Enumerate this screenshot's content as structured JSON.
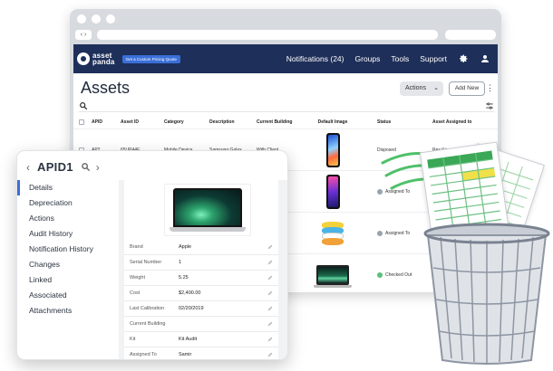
{
  "app": {
    "logo_text_1": "asset",
    "logo_text_2": "panda",
    "quote_button": "Get a Custom Pricing Quote",
    "nav": {
      "notifications": "Notifications (24)",
      "groups": "Groups",
      "tools": "Tools",
      "support": "Support"
    },
    "brand_color": "#1e2f59",
    "accent_color": "#3a6fd8"
  },
  "page": {
    "title": "Assets",
    "actions_label": "Actions",
    "add_new_label": "Add New"
  },
  "table": {
    "headers": {
      "apid": "APID",
      "asset_id": "Asset ID",
      "category": "Category",
      "description": "Description",
      "current_building": "Current Building",
      "default_image": "Default Image",
      "status": "Status",
      "assigned_to": "Asset Assigned to"
    },
    "rows": [
      {
        "apid": "AP2",
        "asset_id": "65UP44E",
        "category": "Mobile Device",
        "description": "Samsung Galax...",
        "building": "With Client",
        "status": "Disposed",
        "assigned": "Rex King",
        "status_color": "#9aa3b0"
      },
      {
        "apid": "",
        "asset_id": "",
        "category": "",
        "description": "",
        "building": "",
        "status": "Assigned To",
        "assigned": "",
        "status_color": "#9aa3b0"
      },
      {
        "apid": "",
        "asset_id": "",
        "category": "",
        "description": "",
        "building": "",
        "status": "Assigned To",
        "assigned": "",
        "status_color": "#9aa3b0"
      },
      {
        "apid": "",
        "asset_id": "",
        "category": "",
        "description": "",
        "building": "",
        "status": "Checked Out",
        "assigned": "",
        "status_color": "#5bbf7a"
      }
    ]
  },
  "detail": {
    "title": "APID1",
    "nav_prev": "‹",
    "nav_next": "›",
    "sidebar": [
      {
        "label": "Details",
        "active": true
      },
      {
        "label": "Depreciation",
        "active": false
      },
      {
        "label": "Actions",
        "active": false
      },
      {
        "label": "Audit History",
        "active": false
      },
      {
        "label": "Notification History",
        "active": false
      },
      {
        "label": "Changes",
        "active": false
      },
      {
        "label": "Linked",
        "active": false
      },
      {
        "label": "Associated",
        "active": false
      },
      {
        "label": "Attachments",
        "active": false
      }
    ],
    "fields": [
      {
        "label": "Brand",
        "value": "Apple"
      },
      {
        "label": "Serial Number",
        "value": "1"
      },
      {
        "label": "Weight",
        "value": "5.25"
      },
      {
        "label": "Cost",
        "value": "$2,400.00"
      },
      {
        "label": "Last Calibration",
        "value": "02/20/2019"
      },
      {
        "label": "Current Building",
        "value": ""
      },
      {
        "label": "Kit",
        "value": "Kit Audit"
      },
      {
        "label": "Assigned To",
        "value": "Samir"
      }
    ]
  },
  "icons": {
    "gear": "gear-icon",
    "user": "user-icon",
    "search": "search-icon",
    "filter": "filter-icon",
    "pencil": "pencil-icon",
    "trash": "trash-can-icon"
  }
}
